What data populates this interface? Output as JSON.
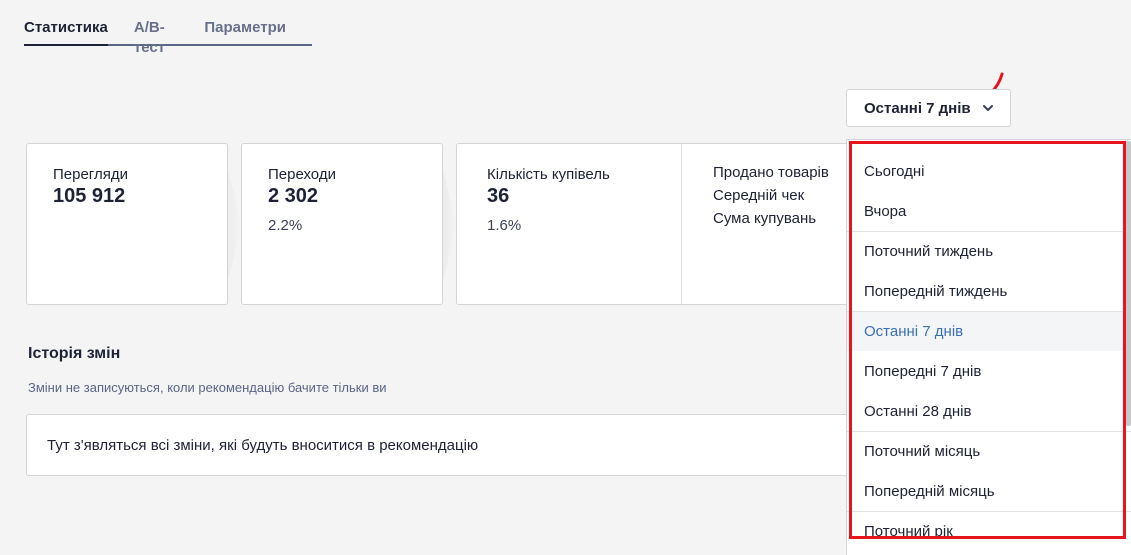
{
  "tabs": [
    {
      "label": "Статистика",
      "active": true
    },
    {
      "label": "A/B-тест",
      "active": false
    },
    {
      "label": "Параметри",
      "active": false
    }
  ],
  "period": {
    "selected": "Останні 7 днів"
  },
  "cards": [
    {
      "label": "Перегляди",
      "value": "105 912",
      "pct": ""
    },
    {
      "label": "Переходи",
      "value": "2 302",
      "pct": "2.2%"
    },
    {
      "label": "Кількість купівель",
      "value": "36",
      "pct": "1.6%"
    }
  ],
  "extra_metrics": [
    "Продано товарів",
    "Середній чек",
    "Сума купувань"
  ],
  "history": {
    "title": "Історія змін",
    "note": "Зміни не записуються, коли рекомендацію бачите тільки ви",
    "empty_text": "Тут з'являться всі зміни, які будуть вноситися в рекомендацію"
  },
  "dropdown": {
    "items": [
      {
        "label": "Сьогодні"
      },
      {
        "label": "Вчора"
      },
      {
        "label": "Поточний тиждень"
      },
      {
        "label": "Попередній тиждень"
      },
      {
        "label": "Останні 7 днів"
      },
      {
        "label": "Попередні 7 днів"
      },
      {
        "label": "Останні 28 днів"
      },
      {
        "label": "Поточний місяць"
      },
      {
        "label": "Попередній місяць"
      },
      {
        "label": "Поточний рік"
      }
    ]
  },
  "colors": {
    "accent": "#3b6fb6",
    "highlight": "#e8141c",
    "text": "#1e2235"
  }
}
